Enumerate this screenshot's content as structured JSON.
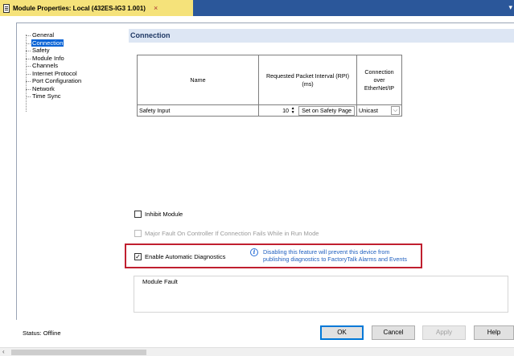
{
  "tab": {
    "title": "Module Properties: Local (432ES-IG3 1.001)",
    "close": "×",
    "more": "▾"
  },
  "tree": {
    "items": [
      {
        "label": "General",
        "selected": false
      },
      {
        "label": "Connection",
        "selected": true
      },
      {
        "label": "Safety",
        "selected": false
      },
      {
        "label": "Module Info",
        "selected": false
      },
      {
        "label": "Channels",
        "selected": false
      },
      {
        "label": "Internet Protocol",
        "selected": false
      },
      {
        "label": "Port Configuration",
        "selected": false
      },
      {
        "label": "Network",
        "selected": false
      },
      {
        "label": "Time Sync",
        "selected": false
      }
    ]
  },
  "section": {
    "title": "Connection"
  },
  "table": {
    "headers": {
      "name": "Name",
      "rpi": "Requested Packet Interval (RPI) (ms)",
      "conn": "Connection over EtherNet/IP"
    },
    "rows": [
      {
        "name": "Safety Input",
        "rpi": "10",
        "rpi_mode": "Set on Safety Page",
        "connection": "Unicast"
      }
    ]
  },
  "options": {
    "inhibit": {
      "label": "Inhibit Module",
      "checked": false
    },
    "major_fault": {
      "label": "Major Fault On Controller If Connection Fails While in Run Mode",
      "checked": false,
      "disabled": true
    },
    "auto_diag": {
      "label": "Enable Automatic Diagnostics",
      "checked": true,
      "mark": "✓"
    }
  },
  "info": {
    "icon": "i",
    "line1": "Disabling this feature will prevent this device from",
    "line2": "publishing diagnostics to FactoryTalk Alarms and Events"
  },
  "fault": {
    "label": "Module Fault"
  },
  "status": {
    "text": "Status:  Offline"
  },
  "buttons": {
    "ok": "OK",
    "cancel": "Cancel",
    "apply": "Apply",
    "help": "Help"
  },
  "colors": {
    "tab_bg": "#f5e27a",
    "tabbar_bg": "#2b579a",
    "highlight": "#c01f2f",
    "info_text": "#1f5fbf",
    "selected": "#0a64d6"
  }
}
